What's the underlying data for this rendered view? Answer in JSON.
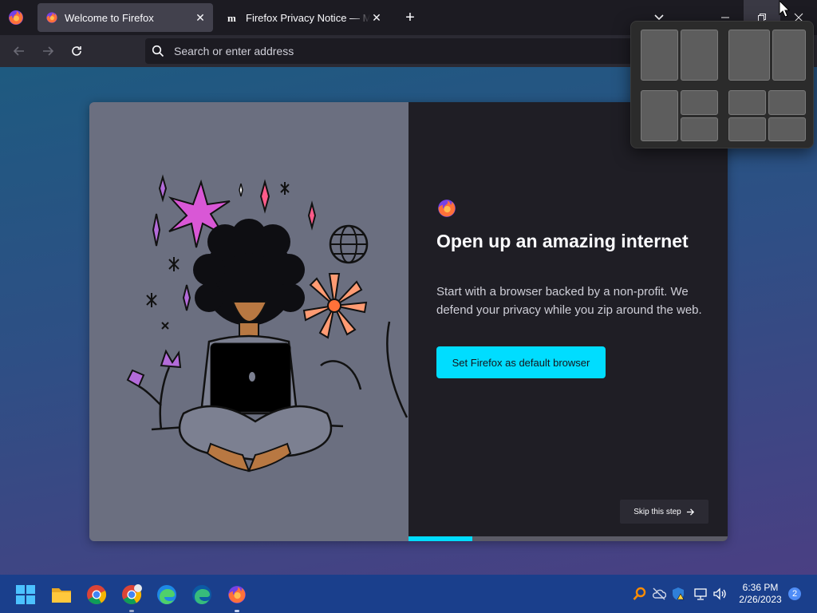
{
  "tabs": [
    {
      "title": "Welcome to Firefox",
      "active": true
    },
    {
      "title": "Firefox Privacy Notice — Mozilla",
      "active": false
    }
  ],
  "urlbar": {
    "placeholder": "Search or enter address"
  },
  "onboarding": {
    "headline": "Open up an amazing internet",
    "subtitle": "Start with a browser backed by a non-profit. We defend your privacy while you zip around the web.",
    "primary_button": "Set Firefox as default browser",
    "skip_button": "Skip this step",
    "progress_fraction": 0.2
  },
  "taskbar": {
    "time": "6:36 PM",
    "date": "2/26/2023",
    "notification_count": "2"
  },
  "colors": {
    "accent": "#00ddff",
    "taskbar": "#1a3f8c",
    "card_left": "#6b6f80",
    "card_right": "#1f1e25"
  },
  "icons": [
    "firefox-icon",
    "close-icon",
    "plus-icon",
    "chevron-down-icon",
    "minimize-icon",
    "restore-icon",
    "back-arrow-icon",
    "forward-arrow-icon",
    "reload-icon",
    "search-icon",
    "arrow-right-icon",
    "windows-start-icon",
    "folder-icon",
    "chrome-icon",
    "edge-icon",
    "search-tray-icon",
    "cloud-icon",
    "shield-icon",
    "network-icon",
    "volume-icon"
  ]
}
